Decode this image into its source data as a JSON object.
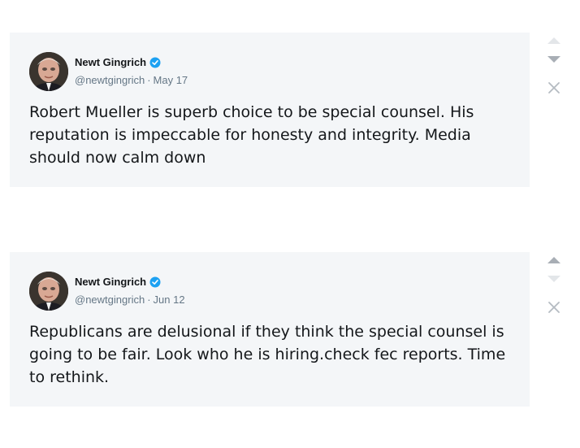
{
  "tweets": [
    {
      "display_name": "Newt Gingrich",
      "handle": "@newtgingrich",
      "separator": "·",
      "date": "May 17",
      "text": "Robert Mueller is superb choice to be special counsel. His reputation is impeccable for honesty and integrity. Media should now calm down",
      "verified_icon": "verified-badge-icon",
      "controls": {
        "up_state": "faint",
        "down_state": "strong",
        "close_icon": "close-icon"
      }
    },
    {
      "display_name": "Newt Gingrich",
      "handle": "@newtgingrich",
      "separator": "·",
      "date": "Jun 12",
      "text": "Republicans are delusional if they think the special counsel is going to be fair. Look who he is hiring.check fec reports. Time to rethink.",
      "verified_icon": "verified-badge-icon",
      "controls": {
        "up_state": "strong",
        "down_state": "faint",
        "close_icon": "close-icon"
      }
    }
  ],
  "colors": {
    "card_background": "#f4f6f8",
    "verified_blue": "#1da1f2",
    "text_primary": "#14171a",
    "text_secondary": "#657786"
  }
}
